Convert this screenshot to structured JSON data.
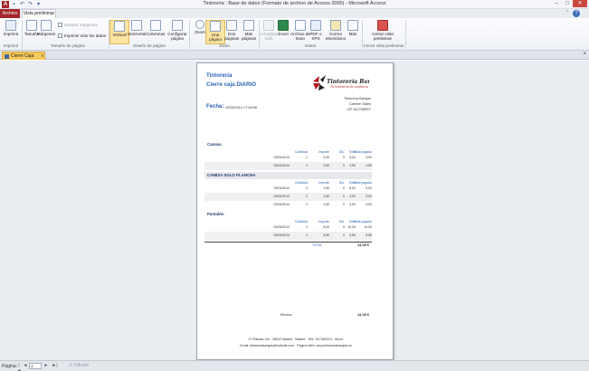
{
  "window": {
    "app_icon": "A",
    "title": "Tintorería : Base de datos (Formato de archivo de Access 2000) - Microsoft Access",
    "controls": {
      "minimize": "–",
      "maximize": "□",
      "close": "✕"
    },
    "quick_access": [
      "save-icon",
      "undo-icon",
      "redo-icon",
      "dropdown-icon"
    ]
  },
  "tabs": {
    "file": "Archivo",
    "active": "Vista preliminar"
  },
  "ribbon": {
    "groups": {
      "print": {
        "label": "Imprimir",
        "buttons": [
          {
            "label": "Imprimir",
            "icon": "printer-icon"
          }
        ]
      },
      "page_size": {
        "label": "Tamaño de página",
        "buttons": [
          {
            "label": "Tamaño",
            "icon": "page-size-icon"
          },
          {
            "label": "Márgenes",
            "icon": "margins-icon"
          }
        ],
        "checkboxes": [
          {
            "label": "Mostrar márgenes",
            "disabled": true
          },
          {
            "label": "Imprimir sólo los datos",
            "disabled": false
          }
        ]
      },
      "page_design": {
        "label": "Diseño de página",
        "buttons": [
          {
            "label": "Vertical",
            "icon": "portrait-icon",
            "selected": true
          },
          {
            "label": "Horizontal",
            "icon": "landscape-icon"
          },
          {
            "label": "Columnas",
            "icon": "columns-icon"
          },
          {
            "label": "Configurar página",
            "icon": "page-setup-icon"
          }
        ]
      },
      "zoom": {
        "label": "Zoom",
        "buttons": [
          {
            "label": "Zoom",
            "icon": "zoom-icon"
          },
          {
            "label": "Una página",
            "icon": "one-page-icon",
            "selected": true
          },
          {
            "label": "Dos páginas",
            "icon": "two-pages-icon"
          },
          {
            "label": "Más páginas",
            "icon": "more-pages-icon"
          }
        ]
      },
      "data": {
        "label": "Datos",
        "buttons": [
          {
            "label": "Actualizar todo",
            "icon": "refresh-icon",
            "disabled": true
          },
          {
            "label": "Excel",
            "icon": "excel-icon"
          },
          {
            "label": "Archivo de texto",
            "icon": "text-file-icon"
          },
          {
            "label": "PDF o XPS",
            "icon": "pdf-icon"
          },
          {
            "label": "Correo electrónico",
            "icon": "email-icon"
          },
          {
            "label": "Más",
            "icon": "more-icon"
          }
        ]
      },
      "close": {
        "label": "Cerrar vista preliminar",
        "buttons": [
          {
            "label": "Cerrar vista preliminar",
            "icon": "close-preview-icon"
          }
        ]
      }
    }
  },
  "document_tab": {
    "label": "Cierre Caja DIARIO",
    "icon": "report-icon",
    "close": "x"
  },
  "report": {
    "title": "Tintorería",
    "subtitle": "Cierre caja DIARIO",
    "logo_text": "Tintorería Barajas",
    "logo_tagline": "Tu tintorería de confianza",
    "company": {
      "name": "Tintorería Barajas",
      "owner": "Carmen Sales",
      "cif": "CIF 51270895Y"
    },
    "fecha_label": "Fecha:",
    "fecha_value": "22/05/2014 17:48:58",
    "column_headers": {
      "cantidad": "Cantidad",
      "importe": "Importe",
      "dto": "Dto.",
      "total": "Total",
      "total_pagado": "Total pagado"
    },
    "sections": [
      {
        "name": "Camisa",
        "rows": [
          {
            "fecha": "03/04/2014",
            "cantidad": "1",
            "importe": "3,00",
            "dto": "0",
            "total": "3,00",
            "total_pagado": "3,00"
          },
          {
            "fecha": "03/04/2014",
            "cantidad": "1",
            "importe": "2,50",
            "dto": "0",
            "total": "2,50",
            "total_pagado": "4,50"
          }
        ]
      },
      {
        "name": "CAMISA  SOLO PLANCHA",
        "rows": [
          {
            "fecha": "03/04/2014",
            "cantidad": "4",
            "importe": "1,50",
            "dto": "0",
            "total": "6,00",
            "total_pagado": "6,00"
          },
          {
            "fecha": "03/04/2014",
            "cantidad": "2",
            "importe": "1,50",
            "dto": "0",
            "total": "3,00",
            "total_pagado": "3,00"
          },
          {
            "fecha": "03/04/2014",
            "cantidad": "2",
            "importe": "1,50",
            "dto": "0",
            "total": "3,00",
            "total_pagado": "3,00"
          }
        ]
      },
      {
        "name": "Pantalón",
        "rows": [
          {
            "fecha": "03/04/2014",
            "cantidad": "2",
            "importe": "5,00",
            "dto": "0",
            "total": "10,00",
            "total_pagado": "10,00"
          },
          {
            "fecha": "03/04/2014",
            "cantidad": "1",
            "importe": "5,50",
            "dto": "0",
            "total": "5,50",
            "total_pagado": "5,50"
          }
        ]
      }
    ],
    "total_label": "TOTAL",
    "total_value": "41,00 €",
    "efectivo_label": "Efectivo",
    "efectivo_value": "41,00 €",
    "footer_line1": "C/ Plaseta, s/n · 28042 Madrid · Madrid · Telf.: 917482214 · Movil:",
    "footer_line2": "Email: tintoreriabarajas@hotmail.com · Página Web: www.tintoreriabarajas.es"
  },
  "statusbar": {
    "page_label": "Página:",
    "first": "|◄",
    "prev": "◄",
    "page_value": "1",
    "next": "►",
    "last": "►|",
    "filter": "Filtrado"
  }
}
